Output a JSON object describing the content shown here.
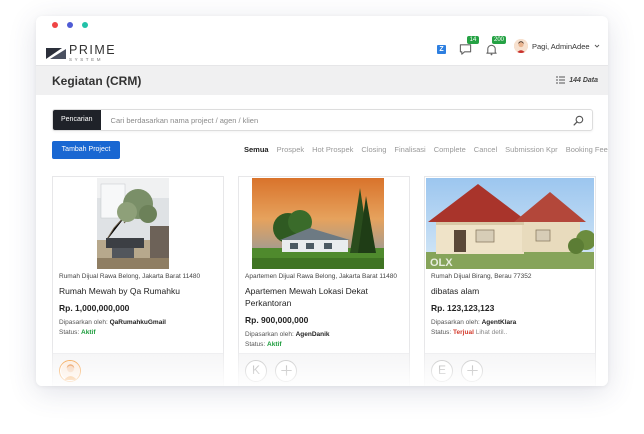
{
  "window_dots": [
    "#ef4444",
    "#4f5bd5",
    "#22c1a8"
  ],
  "brand": {
    "name": "PRIME",
    "sub": "SYSTEM"
  },
  "topbar": {
    "z_badge": "Z",
    "messages_count": "14",
    "notifications_count": "200",
    "user_name": "Pagi, AdminAdee"
  },
  "page": {
    "title": "Kegiatan (CRM)",
    "data_count": "144 Data"
  },
  "search": {
    "label": "Pencarian",
    "placeholder": "Cari berdasarkan nama project / agen / klien"
  },
  "add_button": "Tambah Project",
  "filters": [
    "Semua",
    "Prospek",
    "Hot Prospek",
    "Closing",
    "Finalisasi",
    "Complete",
    "Cancel",
    "Submission Kpr",
    "Booking Fee"
  ],
  "active_filter": "Semua",
  "cards": [
    {
      "location": "Rumah Dijual Rawa Belong, Jakarta Barat 11480",
      "title": "Rumah Mewah by Qa Rumahku",
      "price": "Rp. 1,000,000,000",
      "marketed_by_label": "Dipasarkan oleh:",
      "agent": "QaRumahkuGmail",
      "status_label": "Status:",
      "status": "Aktif",
      "status_note": ""
    },
    {
      "location": "Apartemen Dijual Rawa Belong, Jakarta Barat 11480",
      "title": "Apartemen Mewah Lokasi Dekat Perkantoran",
      "price": "Rp. 900,000,000",
      "marketed_by_label": "Dipasarkan oleh:",
      "agent": "AgenDanik",
      "status_label": "Status:",
      "status": "Aktif",
      "status_note": "",
      "agent_initial": "K"
    },
    {
      "location": "Rumah Dijual Birang, Berau 77352",
      "title": "dibatas alam",
      "price": "Rp. 123,123,123",
      "marketed_by_label": "Dipasarkan oleh:",
      "agent": "AgentKlara",
      "status_label": "Status:",
      "status": "Terjual",
      "status_note": "Lihat detil..",
      "agent_initial": "E",
      "watermark": "OLX"
    }
  ],
  "icons": [
    "logo-mark-icon",
    "chat-icon",
    "bell-icon",
    "chevron-down-icon",
    "list-icon",
    "search-icon",
    "plus-icon"
  ]
}
